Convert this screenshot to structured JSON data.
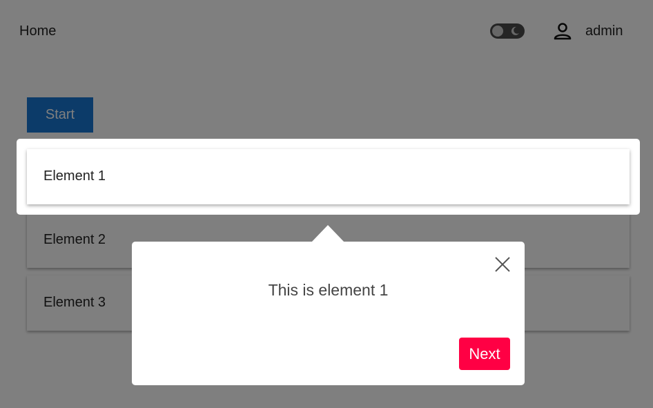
{
  "header": {
    "home_label": "Home",
    "user_name": "admin",
    "icons": {
      "user": "user-icon",
      "theme": "dark-mode-toggle",
      "moon": "moon-icon"
    }
  },
  "main": {
    "start_label": "Start",
    "elements": [
      "Element 1",
      "Element 2",
      "Element 3"
    ]
  },
  "tour": {
    "message": "This is element 1",
    "next_label": "Next",
    "close_icon": "close-icon"
  },
  "colors": {
    "primary": "#1976d2",
    "next_button": "#ff0044",
    "overlay": "rgba(0,0,0,0.5)"
  }
}
